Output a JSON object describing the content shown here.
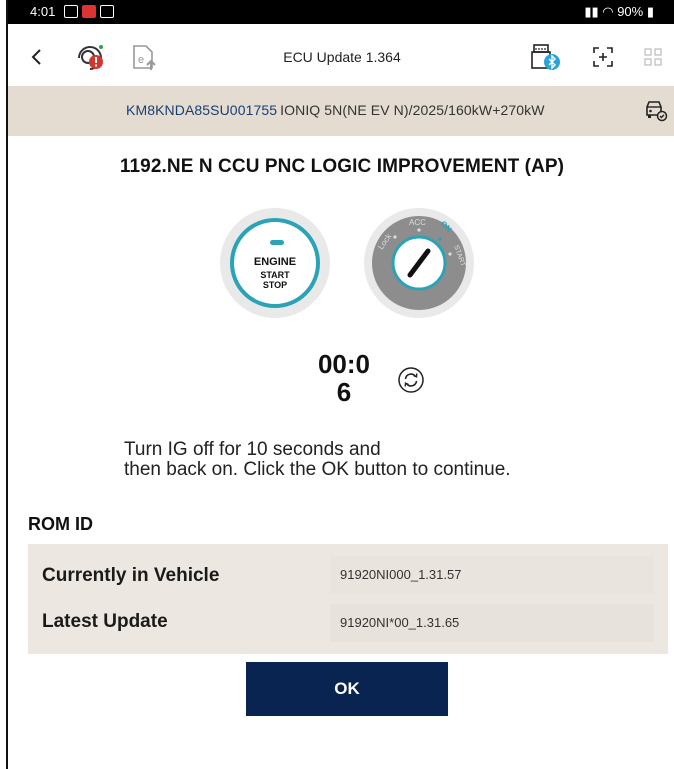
{
  "status_bar": {
    "time": "4:01",
    "right_text": "90%"
  },
  "app_bar": {
    "title": "ECU Update 1.364"
  },
  "vehicle": {
    "vin": "KM8KNDA85SU001755",
    "model": "IONIQ 5N(NE EV N)/2025/160kW+270kW"
  },
  "update": {
    "title": "1192.NE N CCU PNC LOGIC IMPROVEMENT (AP)"
  },
  "engine_button": {
    "line1": "ENGINE",
    "line2": "START",
    "line3": "STOP"
  },
  "ignition": {
    "lock": "Lock",
    "acc": "ACC",
    "on": "ON",
    "start": "START",
    "accent": "#2aa3b6"
  },
  "timer": {
    "line1": "00:0",
    "line2": "6"
  },
  "instruction": {
    "line1": "Turn IG off for 10 seconds and",
    "line2": "then back on. Click the OK button to continue."
  },
  "rom": {
    "label": "ROM ID",
    "rows": [
      {
        "label": "Currently in Vehicle",
        "value": "91920NI000_1.31.57"
      },
      {
        "label": "Latest Update",
        "value": "91920NI*00_1.31.65"
      }
    ]
  },
  "ok_button": {
    "label": "OK"
  },
  "colors": {
    "primary": "#0a2452",
    "accent": "#2aa3b6",
    "vin_bar": "#e4dcd1",
    "vin_text": "#1a3f73"
  }
}
